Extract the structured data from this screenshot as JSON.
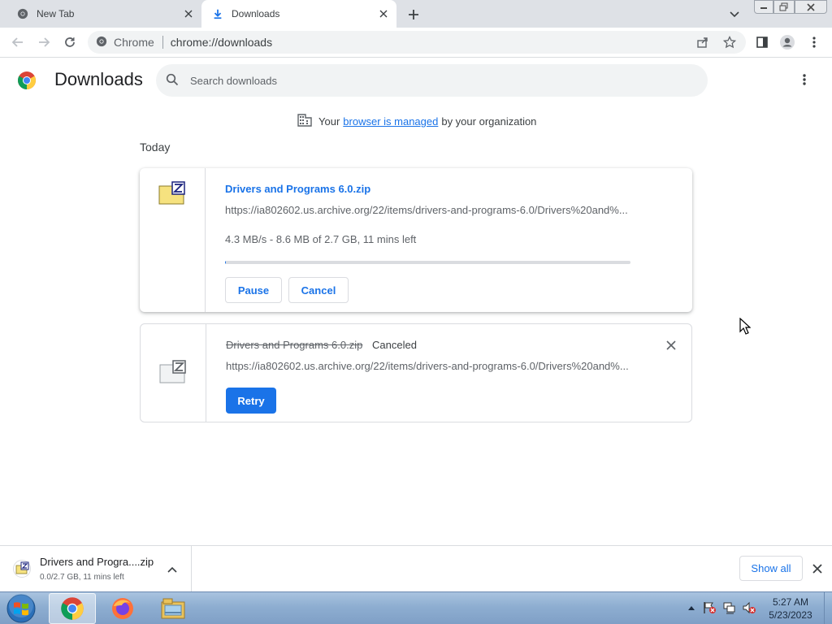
{
  "browser": {
    "tabs": [
      {
        "title": "New Tab",
        "icon": "chrome-icon",
        "active": false
      },
      {
        "title": "Downloads",
        "icon": "download-icon",
        "active": true
      }
    ],
    "omnibox": {
      "site_label": "Chrome",
      "url": "chrome://downloads"
    }
  },
  "page": {
    "title": "Downloads",
    "search_placeholder": "Search downloads",
    "managed": {
      "prefix": "Your",
      "link": "browser is managed",
      "suffix": "by your organization"
    },
    "section_date": "Today"
  },
  "downloads": [
    {
      "filename": "Drivers and Programs 6.0.zip",
      "url": "https://ia802602.us.archive.org/22/items/drivers-and-programs-6.0/Drivers%20and%...",
      "status": "4.3 MB/s - 8.6 MB of 2.7 GB, 11 mins left",
      "progress": 0.003,
      "buttons": {
        "pause": "Pause",
        "cancel": "Cancel"
      }
    },
    {
      "filename": "Drivers and Programs 6.0.zip",
      "url": "https://ia802602.us.archive.org/22/items/drivers-and-programs-6.0/Drivers%20and%...",
      "state": "Canceled",
      "buttons": {
        "retry": "Retry"
      }
    }
  ],
  "shelf": {
    "item_name": "Drivers and Progra....zip",
    "item_status": "0.0/2.7 GB, 11 mins left",
    "show_all": "Show all"
  },
  "taskbar": {
    "time": "5:27 AM",
    "date": "5/23/2023"
  },
  "colors": {
    "accent": "#1a73e8",
    "tab_strip": "#dee1e6"
  }
}
